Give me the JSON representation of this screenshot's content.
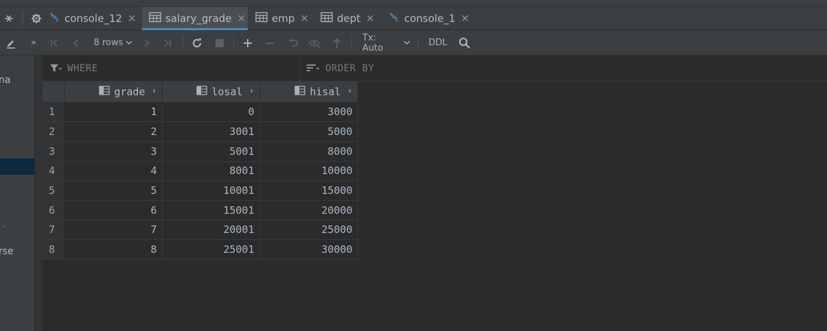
{
  "tabs": [
    {
      "label": "console_12",
      "icon": "console-icon",
      "active": false
    },
    {
      "label": "salary_grade",
      "icon": "table-icon",
      "active": true
    },
    {
      "label": "emp",
      "icon": "table-icon",
      "active": false
    },
    {
      "label": "dept",
      "icon": "table-icon",
      "active": false
    },
    {
      "label": "console_1",
      "icon": "console-icon",
      "active": false
    }
  ],
  "toolbar": {
    "rows_label": "8 rows",
    "tx_label": "Tx: Auto",
    "ddl_label": "DDL"
  },
  "left_panel": {
    "fragments": [
      "na",
      "rse"
    ]
  },
  "filter": {
    "where_label": "WHERE",
    "order_label": "ORDER BY"
  },
  "grid": {
    "columns": [
      "grade",
      "losal",
      "hisal"
    ],
    "rows": [
      {
        "n": "1",
        "grade": "1",
        "losal": "0",
        "hisal": "3000"
      },
      {
        "n": "2",
        "grade": "2",
        "losal": "3001",
        "hisal": "5000"
      },
      {
        "n": "3",
        "grade": "3",
        "losal": "5001",
        "hisal": "8000"
      },
      {
        "n": "4",
        "grade": "4",
        "losal": "8001",
        "hisal": "10000"
      },
      {
        "n": "5",
        "grade": "5",
        "losal": "10001",
        "hisal": "15000"
      },
      {
        "n": "6",
        "grade": "6",
        "losal": "15001",
        "hisal": "20000"
      },
      {
        "n": "7",
        "grade": "7",
        "losal": "20001",
        "hisal": "25000"
      },
      {
        "n": "8",
        "grade": "8",
        "losal": "25001",
        "hisal": "30000"
      }
    ]
  },
  "colors": {
    "accent": "#4a88c7",
    "selection": "#0d293e",
    "panel": "#3c3f41",
    "editor": "#2b2b2b"
  }
}
